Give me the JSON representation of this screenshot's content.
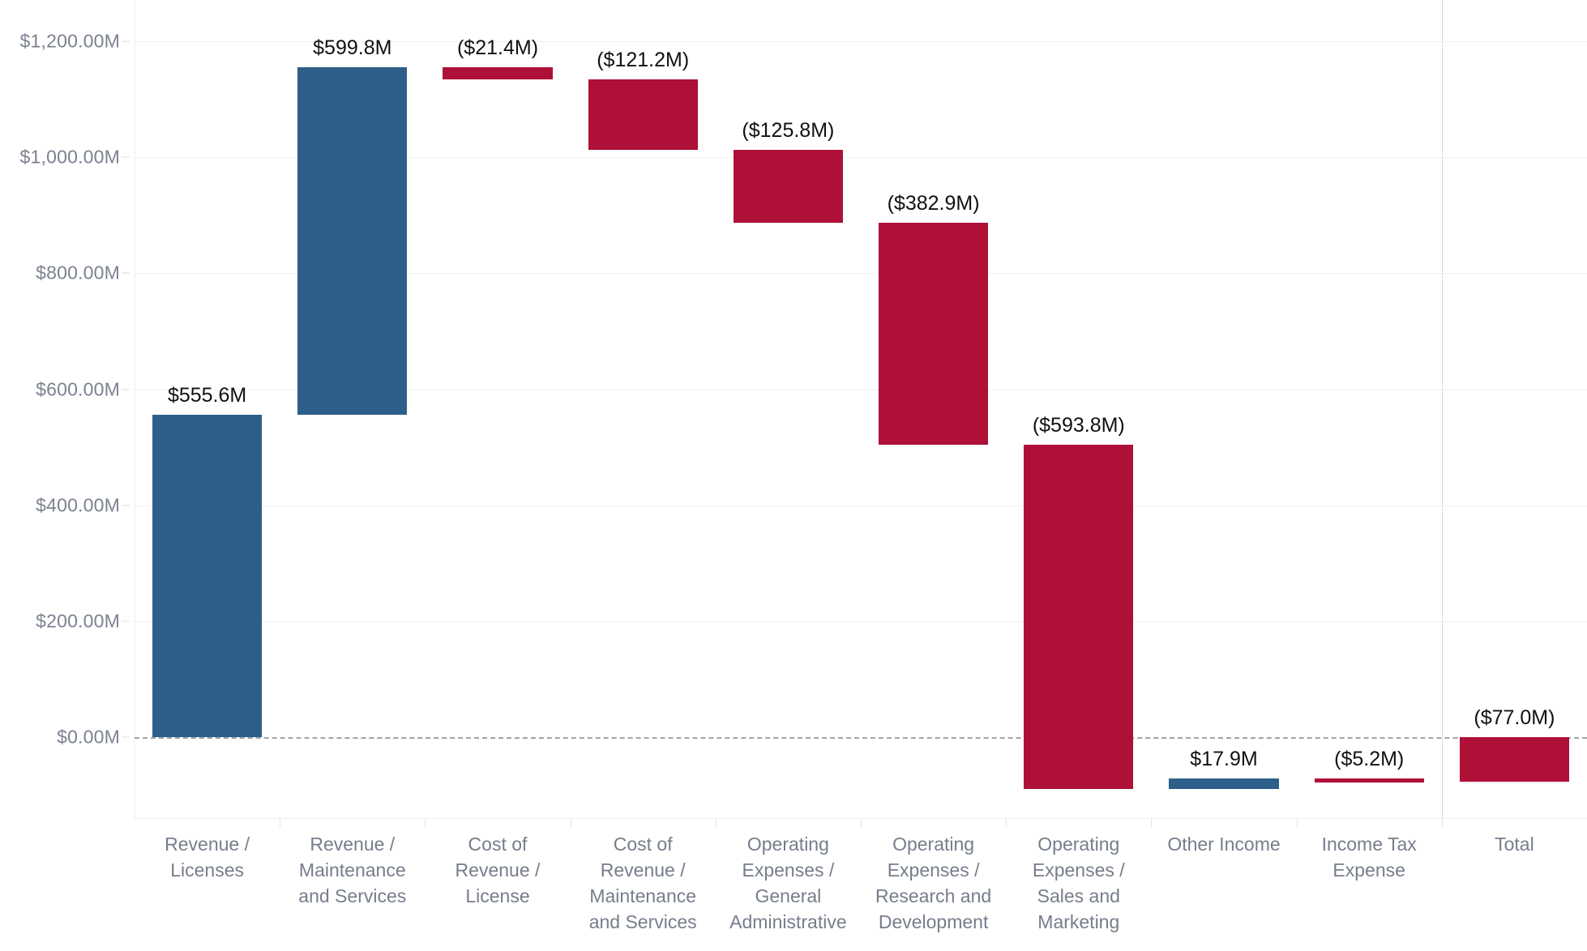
{
  "chart_data": {
    "type": "bar",
    "chart_subtype": "waterfall",
    "title": "",
    "subtitle": "",
    "xlabel": "",
    "ylabel": "",
    "ylim": [
      -200,
      1260
    ],
    "grid": true,
    "legend": false,
    "y_ticks": [
      {
        "value": 1200,
        "label": "$1,200.00M"
      },
      {
        "value": 1000,
        "label": "$1,000.00M"
      },
      {
        "value": 800,
        "label": "$800.00M"
      },
      {
        "value": 600,
        "label": "$600.00M"
      },
      {
        "value": 400,
        "label": "$400.00M"
      },
      {
        "value": 200,
        "label": "$200.00M"
      },
      {
        "value": 0,
        "label": "$0.00M"
      }
    ],
    "units": "Millions USD",
    "categories": [
      "Revenue /\nLicenses",
      "Revenue /\nMaintenance\nand Services",
      "Cost of\nRevenue /\nLicense",
      "Cost of\nRevenue /\nMaintenance\nand Services",
      "Operating\nExpenses /\nGeneral\nAdministrative",
      "Operating\nExpenses /\nResearch and\nDevelopment",
      "Operating\nExpenses /\nSales and\nMarketing",
      "Other Income",
      "Income Tax\nExpense",
      "Total"
    ],
    "values": [
      555.6,
      599.8,
      -21.4,
      -121.2,
      -125.8,
      -382.9,
      -593.8,
      17.9,
      -5.2,
      -77.0
    ],
    "value_labels": [
      "$555.6M",
      "$599.8M",
      "($21.4M)",
      "($121.2M)",
      "($125.8M)",
      "($382.9M)",
      "($593.8M)",
      "$17.9M",
      "($5.2M)",
      "($77.0M)"
    ],
    "cumulative_start": [
      0,
      555.6,
      1155.4,
      1134.0,
      1012.8,
      887.0,
      504.1,
      -89.7,
      -71.8,
      0
    ],
    "cumulative_end": [
      555.6,
      1155.4,
      1134.0,
      1012.8,
      887.0,
      504.1,
      -89.7,
      -71.8,
      -77.0,
      -77.0
    ],
    "is_total": [
      false,
      false,
      false,
      false,
      false,
      false,
      false,
      false,
      false,
      true
    ],
    "colors": {
      "increase": "#2E5F8A",
      "decrease": "#AF1038",
      "gridline": "#F0F1F2",
      "zeroline": "#9FA3A8",
      "axis_text": "#767D8B",
      "label_text": "#111111"
    }
  }
}
